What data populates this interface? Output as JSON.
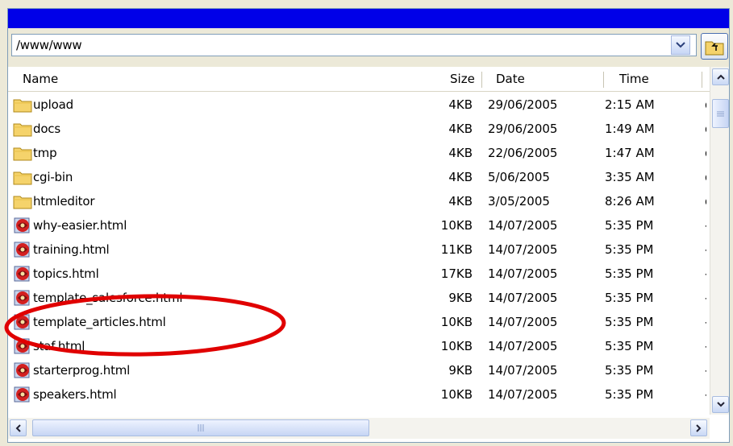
{
  "path": {
    "value": "/www/www"
  },
  "columns": {
    "name": "Name",
    "size": "Size",
    "date": "Date",
    "time": "Time"
  },
  "files": [
    {
      "name": "upload",
      "type": "folder",
      "size": "4KB",
      "date": "29/06/2005",
      "time": "2:15 AM",
      "extra": "d"
    },
    {
      "name": "docs",
      "type": "folder",
      "size": "4KB",
      "date": "29/06/2005",
      "time": "1:49 AM",
      "extra": "d"
    },
    {
      "name": "tmp",
      "type": "folder",
      "size": "4KB",
      "date": "22/06/2005",
      "time": "1:47 AM",
      "extra": "d"
    },
    {
      "name": "cgi-bin",
      "type": "folder",
      "size": "4KB",
      "date": "5/06/2005",
      "time": "3:35 AM",
      "extra": "d"
    },
    {
      "name": "htmleditor",
      "type": "folder",
      "size": "4KB",
      "date": "3/05/2005",
      "time": "8:26 AM",
      "extra": "d"
    },
    {
      "name": "why-easier.html",
      "type": "html",
      "size": "10KB",
      "date": "14/07/2005",
      "time": "5:35 PM",
      "extra": "-"
    },
    {
      "name": "training.html",
      "type": "html",
      "size": "11KB",
      "date": "14/07/2005",
      "time": "5:35 PM",
      "extra": "-"
    },
    {
      "name": "topics.html",
      "type": "html",
      "size": "17KB",
      "date": "14/07/2005",
      "time": "5:35 PM",
      "extra": "-"
    },
    {
      "name": "template_salesforce.html",
      "type": "html",
      "size": "9KB",
      "date": "14/07/2005",
      "time": "5:35 PM",
      "extra": "-"
    },
    {
      "name": "template_articles.html",
      "type": "html",
      "size": "10KB",
      "date": "14/07/2005",
      "time": "5:35 PM",
      "extra": "-"
    },
    {
      "name": "staf.html",
      "type": "html",
      "size": "10KB",
      "date": "14/07/2005",
      "time": "5:35 PM",
      "extra": "-"
    },
    {
      "name": "starterprog.html",
      "type": "html",
      "size": "9KB",
      "date": "14/07/2005",
      "time": "5:35 PM",
      "extra": "-"
    },
    {
      "name": "speakers.html",
      "type": "html",
      "size": "10KB",
      "date": "14/07/2005",
      "time": "5:35 PM",
      "extra": "-"
    }
  ],
  "icons": {
    "folder": "folder-icon",
    "html": "html-file-icon",
    "up": "up-folder-icon",
    "dropdown": "chevron-down-icon"
  },
  "colors": {
    "titlebar": "#0000e8",
    "annotation": "#e00000",
    "folder": "#f5d36b"
  }
}
